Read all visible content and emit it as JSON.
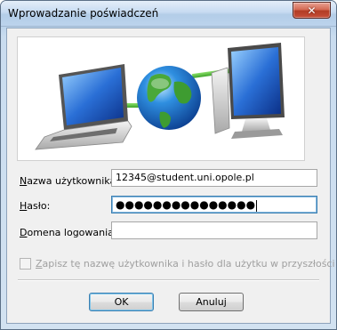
{
  "window": {
    "title": "Wprowadzanie poświadczeń",
    "close_symbol": "✕"
  },
  "banner": {
    "icons": [
      "laptop-icon",
      "globe-icon",
      "desktop-computer-icon"
    ]
  },
  "form": {
    "username": {
      "label_prefix": "",
      "label_accel": "N",
      "label_rest": "azwa użytkownika:",
      "value": "12345@student.uni.opole.pl"
    },
    "password": {
      "label_prefix": "",
      "label_accel": "H",
      "label_rest": "asło:",
      "value": "●●●●●●●●●●●●●●●"
    },
    "domain": {
      "label_prefix": "",
      "label_accel": "D",
      "label_rest": "omena logowania:",
      "value": ""
    }
  },
  "remember": {
    "label_accel": "Z",
    "label_rest": "apisz tę nazwę użytkownika i hasło dla użytku w przyszłości",
    "checked": false,
    "enabled": false
  },
  "buttons": {
    "ok": "OK",
    "cancel": "Anuluj"
  },
  "colors": {
    "accent": "#3c7fb1",
    "close": "#c7503a"
  }
}
